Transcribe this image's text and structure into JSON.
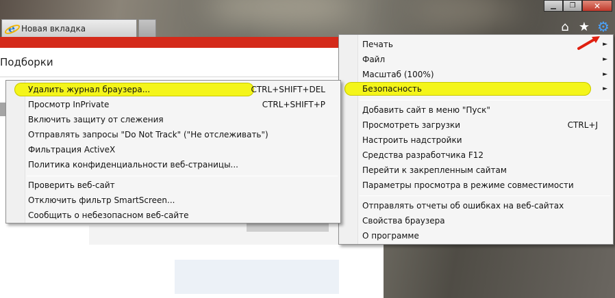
{
  "window": {
    "minimize": "▁",
    "maximize": "❐",
    "close": "✕"
  },
  "tab": {
    "title": "Новая вкладка",
    "icon": "ie-logo-icon"
  },
  "toolbar": {
    "home_icon": "⌂",
    "favorites_icon": "★",
    "tools_icon": "⚙"
  },
  "page": {
    "title": "Подборки"
  },
  "main_menu": {
    "items": [
      {
        "label": "Печать",
        "shortcut": "",
        "has_submenu": true
      },
      {
        "label": "Файл",
        "shortcut": "",
        "has_submenu": true
      },
      {
        "label": "Масштаб (100%)",
        "shortcut": "",
        "has_submenu": true
      },
      {
        "label": "Безопасность",
        "shortcut": "",
        "has_submenu": true
      },
      {
        "label": "Добавить сайт в меню \"Пуск\"",
        "shortcut": ""
      },
      {
        "label": "Просмотреть загрузки",
        "shortcut": "CTRL+J"
      },
      {
        "label": "Настроить надстройки",
        "shortcut": ""
      },
      {
        "label": "Средства разработчика F12",
        "shortcut": ""
      },
      {
        "label": "Перейти к закрепленным сайтам",
        "shortcut": ""
      },
      {
        "label": "Параметры просмотра в режиме совместимости",
        "shortcut": ""
      },
      {
        "label": "Отправлять отчеты об ошибках на веб-сайтах",
        "shortcut": ""
      },
      {
        "label": "Свойства браузера",
        "shortcut": ""
      },
      {
        "label": "О программе",
        "shortcut": ""
      }
    ],
    "chevron": "►"
  },
  "security_submenu": {
    "items": [
      {
        "label": "Удалить журнал браузера...",
        "shortcut": "CTRL+SHIFT+DEL"
      },
      {
        "label": "Просмотр InPrivate",
        "shortcut": "CTRL+SHIFT+P"
      },
      {
        "label": "Включить защиту от слежения",
        "shortcut": ""
      },
      {
        "label": "Отправлять запросы \"Do Not Track\" (\"Не отслеживать\")",
        "shortcut": ""
      },
      {
        "label": "Фильтрация ActiveX",
        "shortcut": ""
      },
      {
        "label": "Политика конфиденциальности веб-страницы...",
        "shortcut": ""
      },
      {
        "label": "Проверить веб-сайт",
        "shortcut": ""
      },
      {
        "label": "Отключить фильтр SmartScreen...",
        "shortcut": ""
      },
      {
        "label": "Сообщить о небезопасном веб-сайте",
        "shortcut": ""
      }
    ]
  },
  "colors": {
    "highlight": "#f4f51a",
    "brand_red": "#d42a1a",
    "arrow_red": "#e02010",
    "gear_blue": "#4aa3ff"
  }
}
